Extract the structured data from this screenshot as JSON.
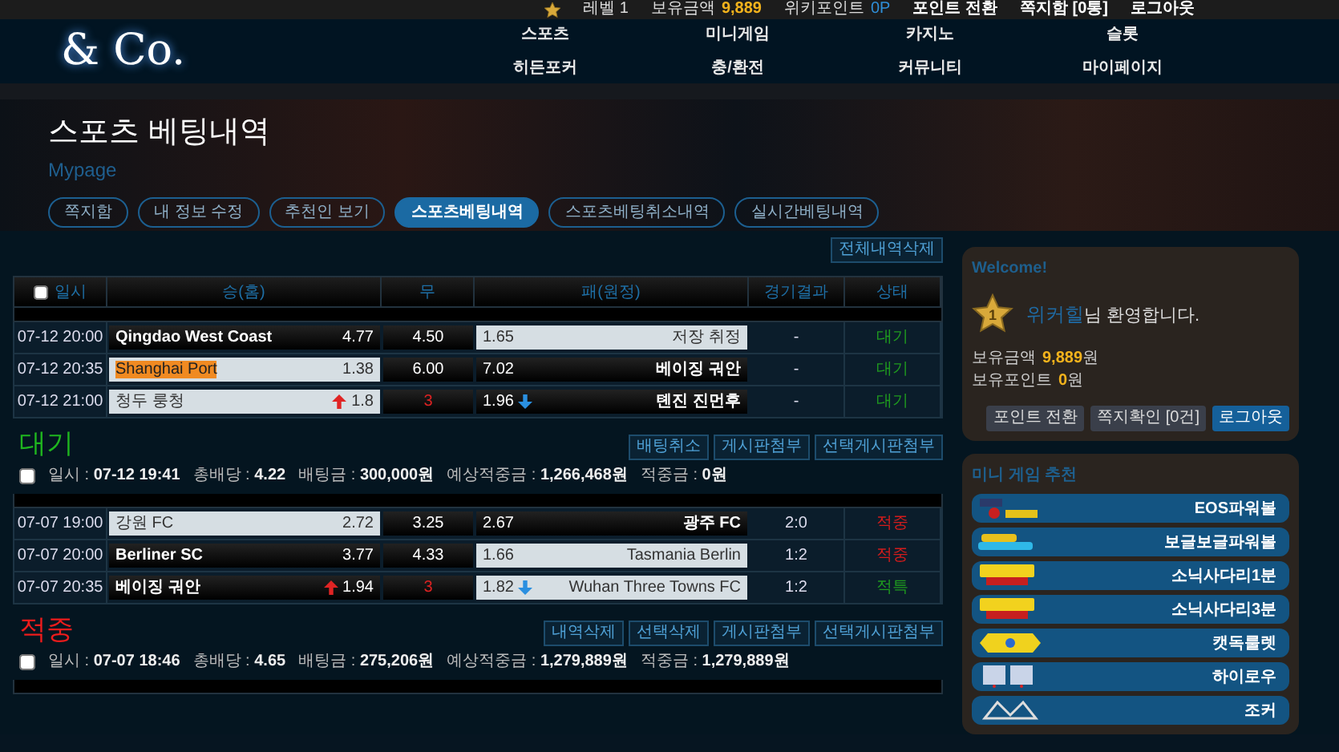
{
  "top_bar": {
    "level": "레벨 1",
    "items": [
      {
        "label": "보유금액",
        "value": "9,889"
      },
      {
        "label": "위키포인트",
        "value": "0P"
      }
    ],
    "links": [
      "포인트 전환",
      "쪽지함 [0통]",
      "로그아웃"
    ]
  },
  "logo": "& Co.",
  "nav": [
    "스포츠",
    "미니게임",
    "카지노",
    "슬롯",
    "히든포커",
    "충/환전",
    "커뮤니티",
    "마이페이지"
  ],
  "hero": {
    "title": "스포츠 베팅내역",
    "subtitle": "Mypage",
    "tabs": [
      {
        "label": "쪽지함",
        "selected": false
      },
      {
        "label": "내 정보 수정",
        "selected": false
      },
      {
        "label": "추천인 보기",
        "selected": false
      },
      {
        "label": "스포츠베팅내역",
        "selected": true
      },
      {
        "label": "스포츠베팅취소내역",
        "selected": false
      },
      {
        "label": "실시간베팅내역",
        "selected": false
      }
    ]
  },
  "delete_all_button": "전체내역삭제",
  "table": {
    "select_all_checked": false,
    "columns": [
      "일시",
      "승(홈)",
      "무",
      "패(원정)",
      "경기결과",
      "상태"
    ],
    "groups": [
      {
        "rows": [
          {
            "time": "07-12 20:00",
            "home": "Qingdao West Coast",
            "home_odds": "4.77",
            "home_up": false,
            "home_selected": false,
            "home_highlighted": false,
            "draw_odds": "4.50",
            "draw_marked": false,
            "away_odds": "1.65",
            "away_down": false,
            "away": "저장 취정",
            "away_selected": true,
            "result": "-",
            "status": "대기",
            "color": "#1f9a1f"
          },
          {
            "time": "07-12 20:35",
            "home": "Shanghai Port",
            "home_odds": "1.38",
            "home_up": false,
            "home_selected": true,
            "home_highlighted": true,
            "draw_odds": "6.00",
            "draw_marked": false,
            "away_odds": "7.02",
            "away_down": false,
            "away": "베이징 궈안",
            "away_selected": false,
            "result": "-",
            "status": "대기",
            "color": "#1f9a1f"
          },
          {
            "time": "07-12 21:00",
            "home": "청두 룽청",
            "home_odds": "1.8",
            "home_up": true,
            "home_selected": true,
            "home_highlighted": false,
            "draw_odds": "3",
            "draw_marked": true,
            "away_odds": "1.96",
            "away_down": true,
            "away": "톈진 진먼후",
            "away_selected": false,
            "result": "-",
            "status": "대기",
            "color": "#1f9a1f"
          }
        ],
        "heading": "대기",
        "color": "#1fb51f",
        "checked": false,
        "summary": [
          "일시 : **07-12 19:41**",
          "총배당 : **4.22**",
          "배팅금 : **300,000원**",
          "예상적중금 : **1,266,468원**",
          "적중금 : **0원**"
        ],
        "buttons": [
          "배팅취소",
          "게시판첨부",
          "선택게시판첨부"
        ]
      },
      {
        "rows": [
          {
            "time": "07-07 19:00",
            "home": "강원 FC",
            "home_odds": "2.72",
            "home_up": false,
            "home_selected": true,
            "home_highlighted": false,
            "draw_odds": "3.25",
            "draw_marked": false,
            "away_odds": "2.67",
            "away_down": false,
            "away": "광주 FC",
            "away_selected": false,
            "result": "2:0",
            "status": "적중",
            "color": "#d41c1c"
          },
          {
            "time": "07-07 20:00",
            "home": "Berliner SC",
            "home_odds": "3.77",
            "home_up": false,
            "home_selected": false,
            "home_highlighted": false,
            "draw_odds": "4.33",
            "draw_marked": false,
            "away_odds": "1.66",
            "away_down": false,
            "away": "Tasmania Berlin",
            "away_selected": true,
            "result": "1:2",
            "status": "적중",
            "color": "#d41c1c"
          },
          {
            "time": "07-07 20:35",
            "home": "베이징 궈안",
            "home_odds": "1.94",
            "home_up": true,
            "home_selected": false,
            "home_highlighted": false,
            "draw_odds": "3",
            "draw_marked": true,
            "away_odds": "1.82",
            "away_down": true,
            "away": "Wuhan Three Towns FC",
            "away_selected": true,
            "result": "1:2",
            "status": "적특",
            "color": "#1f9a1f"
          }
        ],
        "heading": "적중",
        "color": "#ee1c1c",
        "checked": false,
        "summary": [
          "일시 : **07-07 18:46**",
          "총배당 : **4.65**",
          "배팅금 : **275,206원**",
          "예상적중금 : **1,279,889원**",
          "적중금 : **1,279,889원**"
        ],
        "buttons": [
          "내역삭제",
          "선택삭제",
          "게시판첨부",
          "선택게시판첨부"
        ]
      }
    ]
  },
  "sidebar": {
    "welcome": {
      "title": "Welcome!",
      "level_badge": "1",
      "user": "위커힐",
      "greeting": "님 환영합니다.",
      "balances": [
        {
          "label": "보유금액",
          "value": "9,889",
          "unit": "원"
        },
        {
          "label": "보유포인트",
          "value": "0",
          "unit": "원"
        }
      ],
      "buttons": [
        {
          "label": "포인트 전환",
          "kind": "plain"
        },
        {
          "label": "쪽지확인 [0건]",
          "kind": "plain"
        },
        {
          "label": "로그아웃",
          "kind": "primary"
        }
      ]
    },
    "games": {
      "title": "미니 게임 추천",
      "items": [
        {
          "name": "EOS파워볼",
          "kind": "eos"
        },
        {
          "name": "보글보글파워볼",
          "kind": "bubble"
        },
        {
          "name": "소닉사다리1분",
          "kind": "sonic"
        },
        {
          "name": "소닉사다리3분",
          "kind": "sonic"
        },
        {
          "name": "캣독룰렛",
          "kind": "catdog"
        },
        {
          "name": "하이로우",
          "kind": "hilo"
        },
        {
          "name": "조커",
          "kind": "joker"
        }
      ]
    }
  }
}
